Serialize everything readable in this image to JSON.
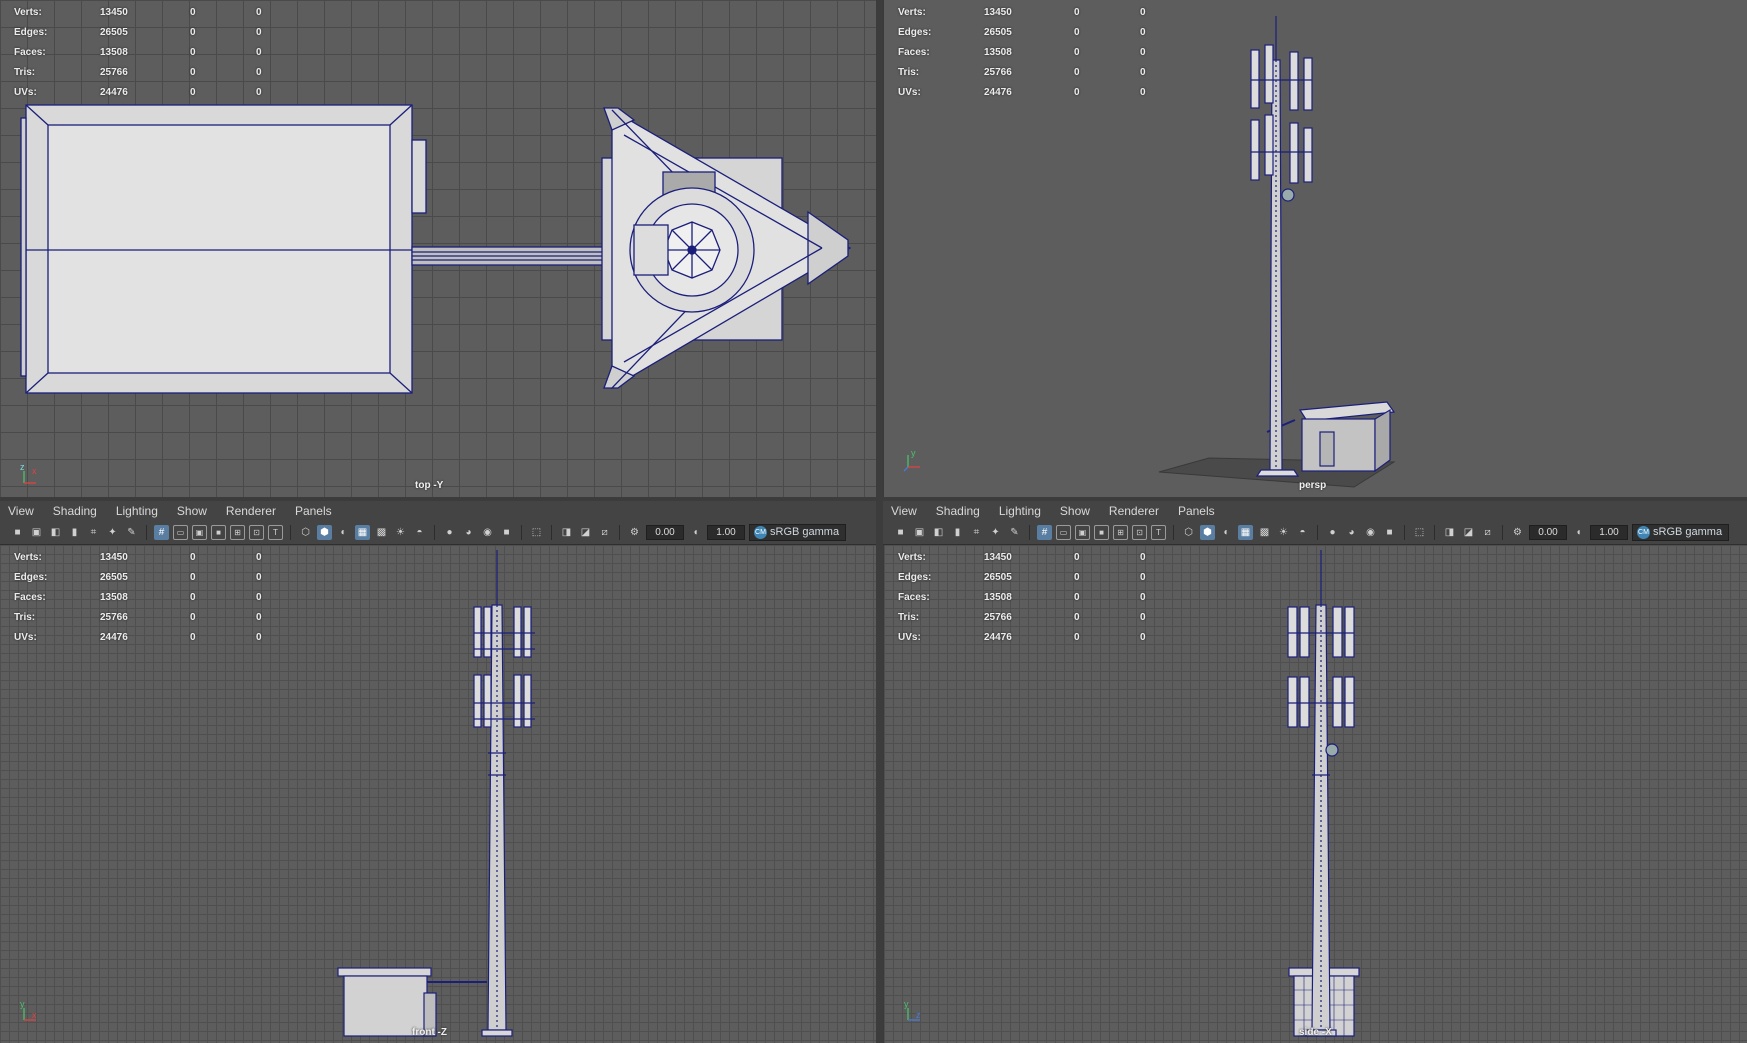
{
  "stats": {
    "rows": [
      {
        "label": "Verts:",
        "value": "13450",
        "selected": "0",
        "extra": "0"
      },
      {
        "label": "Edges:",
        "value": "26505",
        "selected": "0",
        "extra": "0"
      },
      {
        "label": "Faces:",
        "value": "13508",
        "selected": "0",
        "extra": "0"
      },
      {
        "label": "Tris:",
        "value": "25766",
        "selected": "0",
        "extra": "0"
      },
      {
        "label": "UVs:",
        "value": "24476",
        "selected": "0",
        "extra": "0"
      }
    ]
  },
  "viewports": {
    "top": {
      "camera": "top -Y"
    },
    "persp": {
      "camera": "persp"
    },
    "front": {
      "camera": "front -Z"
    },
    "side": {
      "camera": "side -X"
    }
  },
  "panel_menu": [
    "View",
    "Shading",
    "Lighting",
    "Show",
    "Renderer",
    "Panels"
  ],
  "toolbar": {
    "exposure": "0.00",
    "gamma": "1.00",
    "color_space": "sRGB gamma",
    "icons": [
      "camera-icon",
      "camera-attributes-icon",
      "bookmark-icon",
      "image-plane-icon",
      "grid-icon",
      "film-gate-icon",
      "resolution-gate-icon",
      "gate-mask-icon",
      "field-chart-icon",
      "safe-action-icon",
      "safe-title-icon",
      "wireframe-icon",
      "smooth-shade-icon",
      "default-material-icon",
      "textured-icon",
      "use-all-lights-icon",
      "shadows-icon",
      "screen-space-ao-icon",
      "motion-blur-icon",
      "multisample-aa-icon",
      "depth-of-field-icon",
      "isolate-select-icon",
      "xray-icon",
      "xray-joints-icon",
      "xray-active-components-icon",
      "exposure-icon",
      "gamma-icon",
      "color-management-icon"
    ]
  },
  "colors": {
    "viewport_bg": "#5d5d5d",
    "grid_line": "#4a4a4a",
    "wireframe": "#1b1f7a",
    "mesh_fill": "#d9d9d9",
    "active_icon": "#5a7ea2"
  }
}
